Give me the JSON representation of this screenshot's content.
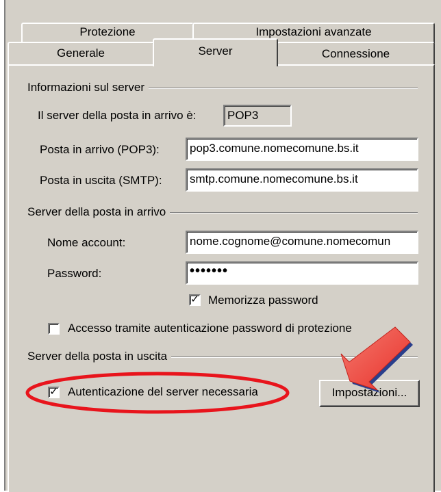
{
  "tabs": {
    "back_row": [
      "Protezione",
      "Impostazioni avanzate"
    ],
    "front_row": [
      "Generale",
      "Server",
      "Connessione"
    ],
    "selected": "Server"
  },
  "server_info": {
    "group_label": "Informazioni sul server",
    "incoming_type_label": "Il server della posta in arrivo è:",
    "incoming_type_value": "POP3",
    "pop3_label": "Posta in arrivo (POP3):",
    "pop3_value": "pop3.comune.nomecomune.bs.it",
    "smtp_label": "Posta in uscita (SMTP):",
    "smtp_value": "smtp.comune.nomecomune.bs.it"
  },
  "incoming": {
    "group_label": "Server della posta in arrivo",
    "account_label": "Nome account:",
    "account_value": "nome.cognome@comune.nomecomun",
    "password_label": "Password:",
    "password_value": "•••••••",
    "remember_label": "Memorizza password",
    "remember_checked": true,
    "spa_label": "Accesso tramite autenticazione password di protezione",
    "spa_checked": false
  },
  "outgoing": {
    "group_label": "Server della posta in uscita",
    "auth_label": "Autenticazione del server necessaria",
    "auth_checked": true,
    "settings_button": "Impostazioni...",
    "check_glyph": "✓"
  },
  "annotation": {
    "highlight_color": "#e8141c",
    "arrow_color": "#f06050"
  }
}
